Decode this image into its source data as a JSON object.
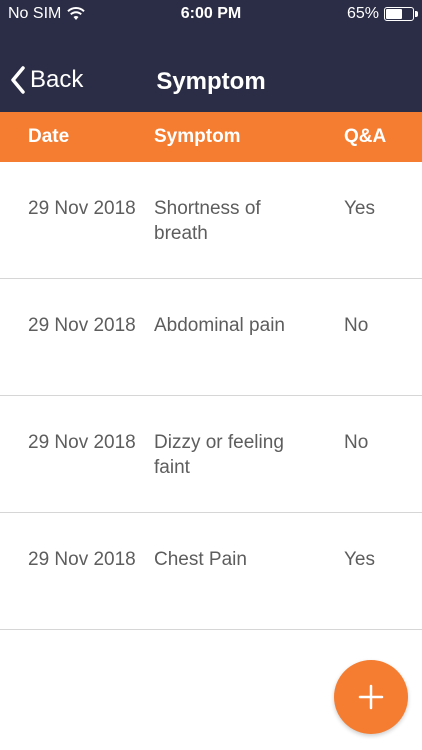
{
  "status_bar": {
    "carrier": "No SIM",
    "time": "6:00 PM",
    "battery_text": "65%",
    "battery_level": 0.65
  },
  "nav": {
    "back_label": "Back",
    "title": "Symptom"
  },
  "table": {
    "headers": {
      "date": "Date",
      "symptom": "Symptom",
      "qa": "Q&A"
    },
    "rows": [
      {
        "date": "29 Nov 2018",
        "symptom": "Shortness of breath",
        "qa": "Yes"
      },
      {
        "date": "29 Nov 2018",
        "symptom": "Abdominal pain",
        "qa": "No"
      },
      {
        "date": "29 Nov 2018",
        "symptom": "Dizzy or feeling faint",
        "qa": "No"
      },
      {
        "date": "29 Nov 2018",
        "symptom": "Chest Pain",
        "qa": "Yes"
      }
    ]
  },
  "fab": {
    "icon": "plus-icon"
  },
  "colors": {
    "navbar": "#2a2d45",
    "accent": "#f47d32",
    "row_text": "#5d5d5d"
  }
}
